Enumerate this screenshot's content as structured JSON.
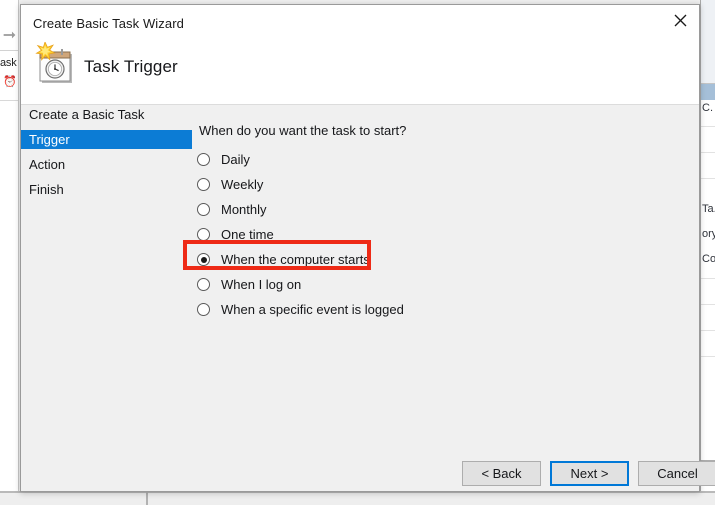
{
  "background": {
    "left_toolbar_icon": "forward-arrow-icon",
    "left_word_fragment": "ask",
    "left_small_icon": "task-clock-icon",
    "right_text_fragments": [
      "C.",
      "Ta.",
      "ory",
      "Co"
    ]
  },
  "dialog": {
    "title": "Create Basic Task Wizard",
    "close_icon": "close-icon",
    "header_icon": "new-scheduled-task-icon",
    "heading": "Task Trigger",
    "nav": {
      "items": [
        {
          "label": "Create a Basic Task",
          "selected": false
        },
        {
          "label": "Trigger",
          "selected": true
        },
        {
          "label": "Action",
          "selected": false
        },
        {
          "label": "Finish",
          "selected": false
        }
      ]
    },
    "question": "When do you want the task to start?",
    "options": [
      {
        "label": "Daily",
        "checked": false
      },
      {
        "label": "Weekly",
        "checked": false
      },
      {
        "label": "Monthly",
        "checked": false
      },
      {
        "label": "One time",
        "checked": false
      },
      {
        "label": "When the computer starts",
        "checked": true
      },
      {
        "label": "When I log on",
        "checked": false
      },
      {
        "label": "When a specific event is logged",
        "checked": false
      }
    ],
    "highlight": {
      "target_option": "When the computer starts",
      "color": "#ee2a16"
    },
    "buttons": {
      "back": "< Back",
      "next": "Next >",
      "cancel": "Cancel",
      "focused": "Next >"
    }
  },
  "colors": {
    "selection_blue": "#0c7cd5",
    "focus_blue": "#0078d7",
    "dialog_bg": "#f0f0f0",
    "header_bg": "#ffffff",
    "highlight_red": "#ee2a16"
  }
}
